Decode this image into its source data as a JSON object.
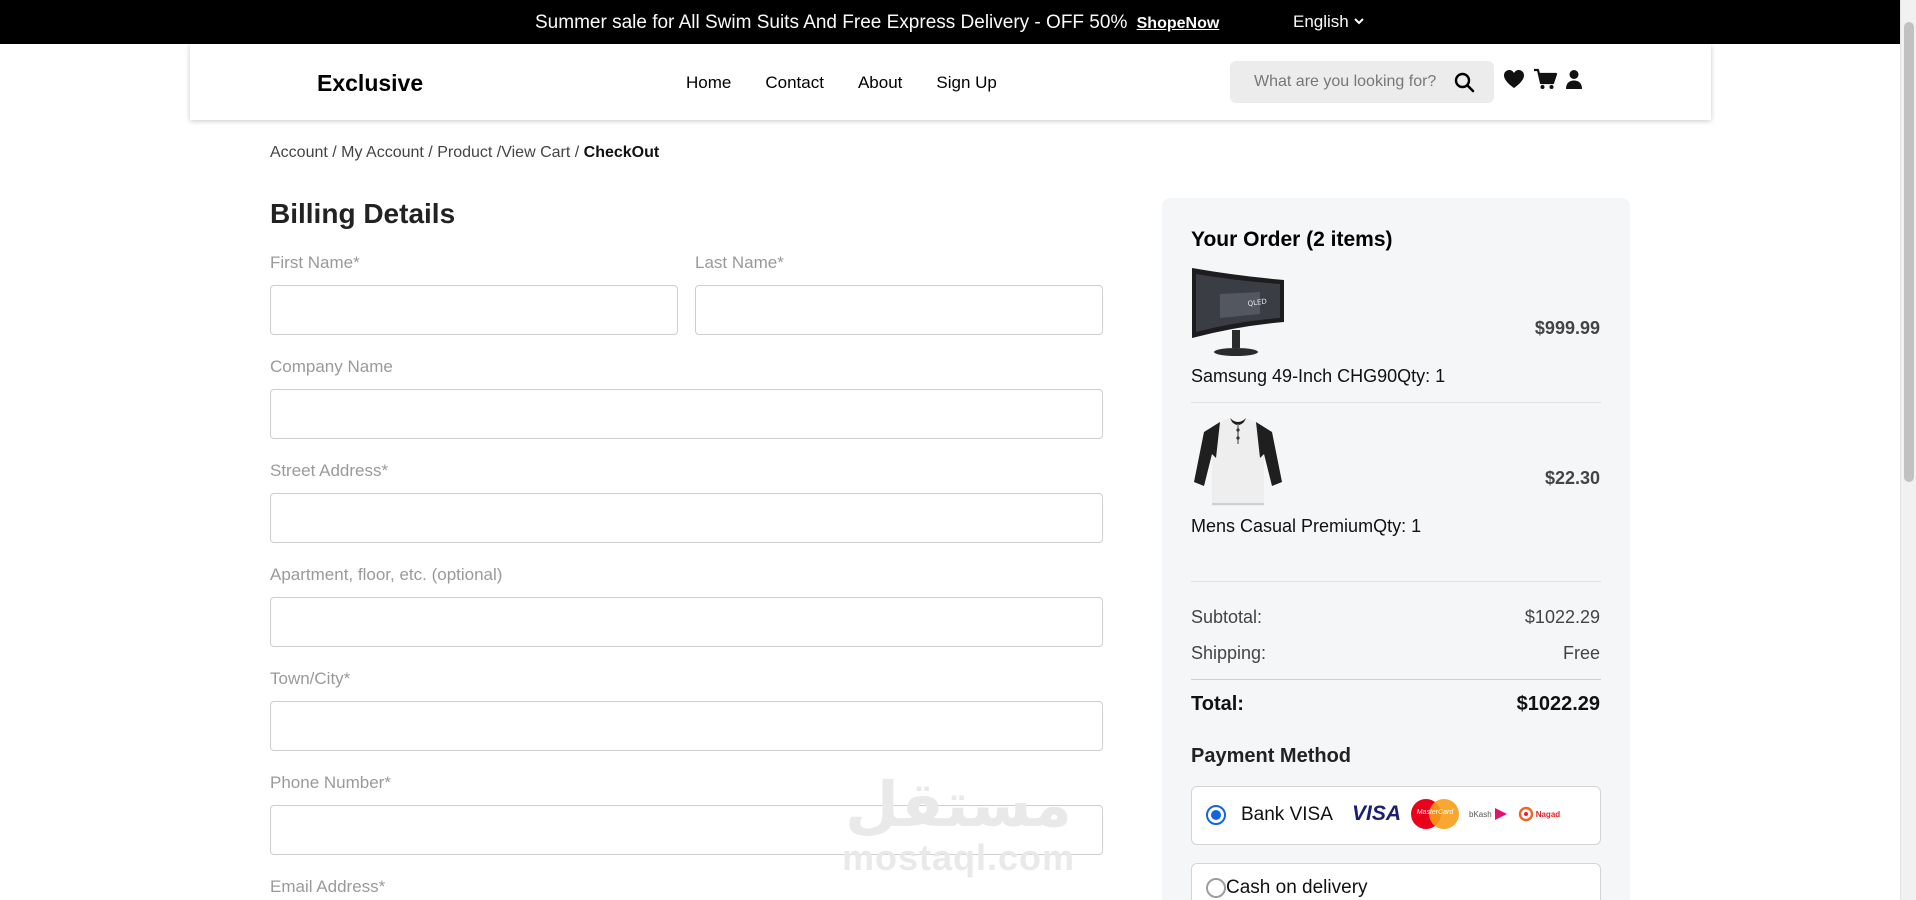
{
  "topbar": {
    "promo_text": "Summer sale for All Swim Suits And Free Express Delivery - OFF 50%",
    "promo_link": "ShopeNow",
    "language": "English"
  },
  "header": {
    "logo": "Exclusive",
    "nav": [
      "Home",
      "Contact",
      "About",
      "Sign Up"
    ],
    "search_placeholder": "What are you looking for?",
    "icons": [
      "heart-icon",
      "cart-icon",
      "user-icon",
      "search-icon"
    ]
  },
  "breadcrumb": {
    "items": [
      "Account",
      "My Account",
      "Product",
      "View Cart"
    ],
    "current": "CheckOut"
  },
  "billing": {
    "title": "Billing Details",
    "fields": [
      {
        "label": "First Name*",
        "value": ""
      },
      {
        "label": "Last Name*",
        "value": ""
      },
      {
        "label": "Company Name",
        "value": ""
      },
      {
        "label": "Street Address*",
        "value": ""
      },
      {
        "label": "Apartment, floor, etc. (optional)",
        "value": ""
      },
      {
        "label": "Town/City*",
        "value": ""
      },
      {
        "label": "Phone Number*",
        "value": ""
      },
      {
        "label": "Email Address*",
        "value": ""
      }
    ]
  },
  "watermark": {
    "arabic": "مستقل",
    "latin": "mostaql.com"
  },
  "order": {
    "title": "Your Order (2 items)",
    "items": [
      {
        "name": "Samsung 49-Inch CHG90",
        "qty": "Qty: 1",
        "price": "$999.99",
        "image": "monitor-image"
      },
      {
        "name": "Mens Casual Premium",
        "qty": "Qty: 1",
        "price": "$22.30",
        "image": "shirt-image"
      }
    ],
    "subtotal_label": "Subtotal:",
    "subtotal_value": "$1022.29",
    "shipping_label": "Shipping:",
    "shipping_value": "Free",
    "total_label": "Total:",
    "total_value": "$1022.29"
  },
  "payment": {
    "title": "Payment Method",
    "options": [
      {
        "label": "Bank VISA",
        "selected": true,
        "logos": [
          "VISA",
          "MasterCard",
          "bKash",
          "Nagad"
        ]
      },
      {
        "label": "Cash on delivery",
        "selected": false
      }
    ]
  },
  "colors": {
    "topbar_bg": "#000000",
    "panel_bg": "#f5f6f8",
    "radio_accent": "#1565d8"
  }
}
